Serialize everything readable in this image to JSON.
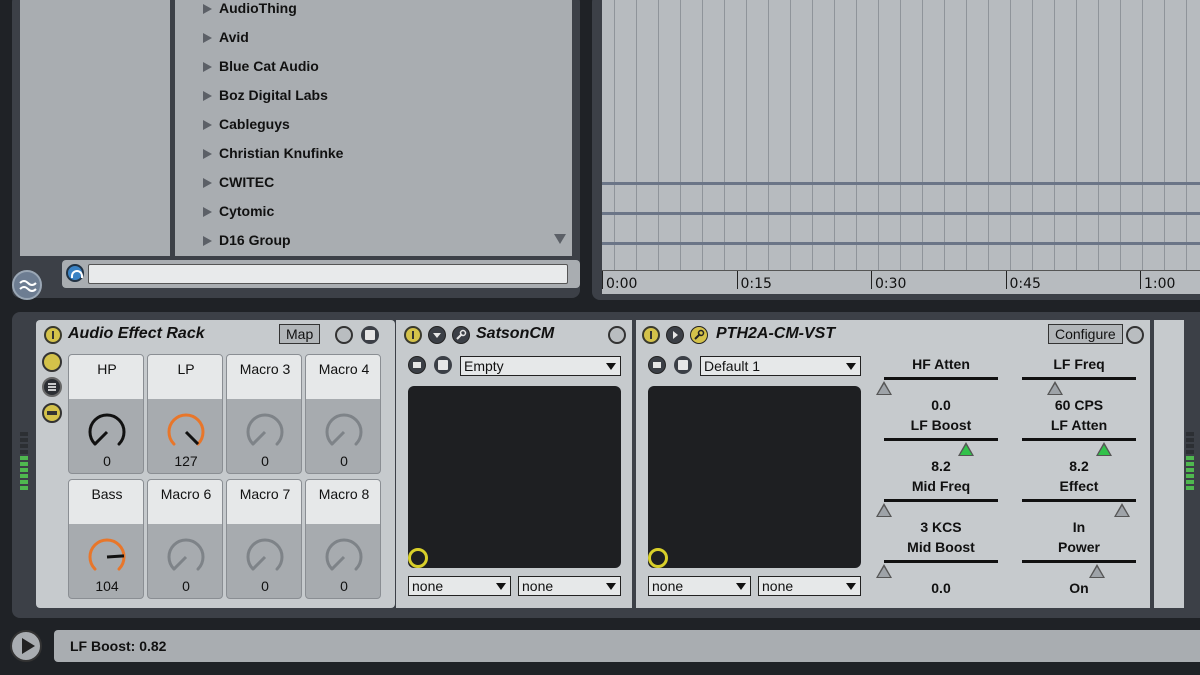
{
  "browser": {
    "items": [
      "AudioThing",
      "Avid",
      "Blue Cat Audio",
      "Boz Digital Labs",
      "Cableguys",
      "Christian Knufinke",
      "CWITEC",
      "Cytomic",
      "D16 Group"
    ],
    "search_value": ""
  },
  "arrangement": {
    "time_labels": [
      "0:00",
      "0:15",
      "0:30",
      "0:45",
      "1:00"
    ]
  },
  "rack": {
    "title": "Audio Effect Rack",
    "map_label": "Map",
    "macros": [
      {
        "name": "HP",
        "value": "0",
        "level": 0.0,
        "color": "#111111",
        "active": true
      },
      {
        "name": "LP",
        "value": "127",
        "level": 1.0,
        "color": "#e8762a",
        "active": true
      },
      {
        "name": "Macro 3",
        "value": "0",
        "level": 0.0,
        "color": "#7e8388",
        "active": false
      },
      {
        "name": "Macro 4",
        "value": "0",
        "level": 0.0,
        "color": "#7e8388",
        "active": false
      },
      {
        "name": "Bass",
        "value": "104",
        "level": 0.82,
        "color": "#e8762a",
        "active": true
      },
      {
        "name": "Macro 6",
        "value": "0",
        "level": 0.0,
        "color": "#7e8388",
        "active": false
      },
      {
        "name": "Macro 7",
        "value": "0",
        "level": 0.0,
        "color": "#7e8388",
        "active": false
      },
      {
        "name": "Macro 8",
        "value": "0",
        "level": 0.0,
        "color": "#7e8388",
        "active": false
      }
    ]
  },
  "satson": {
    "title": "SatsonCM",
    "preset": "Empty",
    "x_select": "none",
    "y_select": "none"
  },
  "pth": {
    "title": "PTH2A-CM-VST",
    "configure_label": "Configure",
    "preset": "Default 1",
    "x_select": "none",
    "y_select": "none",
    "params": [
      {
        "label": "HF Atten",
        "value": "0.0",
        "level": 0.0,
        "active": false
      },
      {
        "label": "LF Freq",
        "value": "60 CPS",
        "level": 0.33,
        "active": false
      },
      {
        "label": "LF Boost",
        "value": "8.2",
        "level": 0.82,
        "active": true
      },
      {
        "label": "LF Atten",
        "value": "8.2",
        "level": 0.82,
        "active": true
      },
      {
        "label": "Mid Freq",
        "value": "3 KCS",
        "level": 0.0,
        "active": false
      },
      {
        "label": "Effect",
        "value": "In",
        "level": 1.0,
        "active": false
      },
      {
        "label": "Mid Boost",
        "value": "0.0",
        "level": 0.0,
        "active": false
      },
      {
        "label": "Power",
        "value": "On",
        "level": 0.75,
        "active": false
      }
    ]
  },
  "status": {
    "text": "LF Boost: 0.82"
  }
}
